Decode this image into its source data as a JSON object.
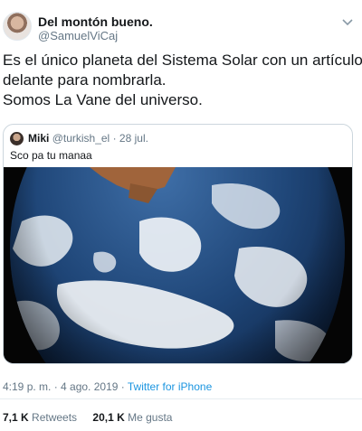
{
  "author": {
    "display_name": "Del montón bueno.",
    "handle": "@SamuelViCaj"
  },
  "tweet": {
    "lines": [
      "Es el único planeta del Sistema Solar con un artículo",
      "delante para nombrarla.",
      "Somos La Vane del universo."
    ]
  },
  "quote": {
    "name": "Miki",
    "handle": "@turkish_el",
    "separator": "·",
    "date": "28 jul.",
    "text": "Sco pa tu manaa"
  },
  "meta": {
    "time": "4:19 p. m. · 4 ago. 2019 ·",
    "source": "Twitter for iPhone"
  },
  "stats": {
    "retweets_count": "7,1 K",
    "retweets_label": "Retweets",
    "likes_count": "20,1 K",
    "likes_label": "Me gusta"
  },
  "icons": {
    "menu": "chevron-down-icon"
  },
  "colors": {
    "link": "#1b95e0",
    "secondary_text": "#657786",
    "border": "#ccd6dd"
  }
}
